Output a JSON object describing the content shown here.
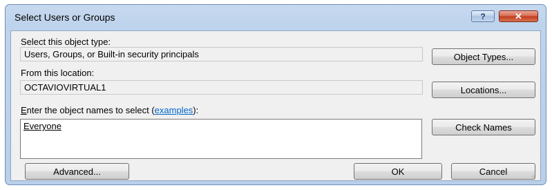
{
  "window": {
    "title": "Select Users or Groups",
    "help_glyph": "?",
    "close_glyph": "✕"
  },
  "object_type": {
    "label": "Select this object type:",
    "value": "Users, Groups, or Built-in security principals",
    "button": "Object Types..."
  },
  "location": {
    "label": "From this location:",
    "value": "OCTAVIOVIRTUAL1",
    "button": "Locations..."
  },
  "names": {
    "label_accel": "E",
    "label_rest": "nter the object names to select (",
    "link": "examples",
    "label_end": "):",
    "value": "Everyone",
    "check_button": "Check Names"
  },
  "footer": {
    "advanced": "Advanced...",
    "ok": "OK",
    "cancel": "Cancel"
  },
  "colors": {
    "link": "#0066cc",
    "close": "#c23b1f"
  }
}
